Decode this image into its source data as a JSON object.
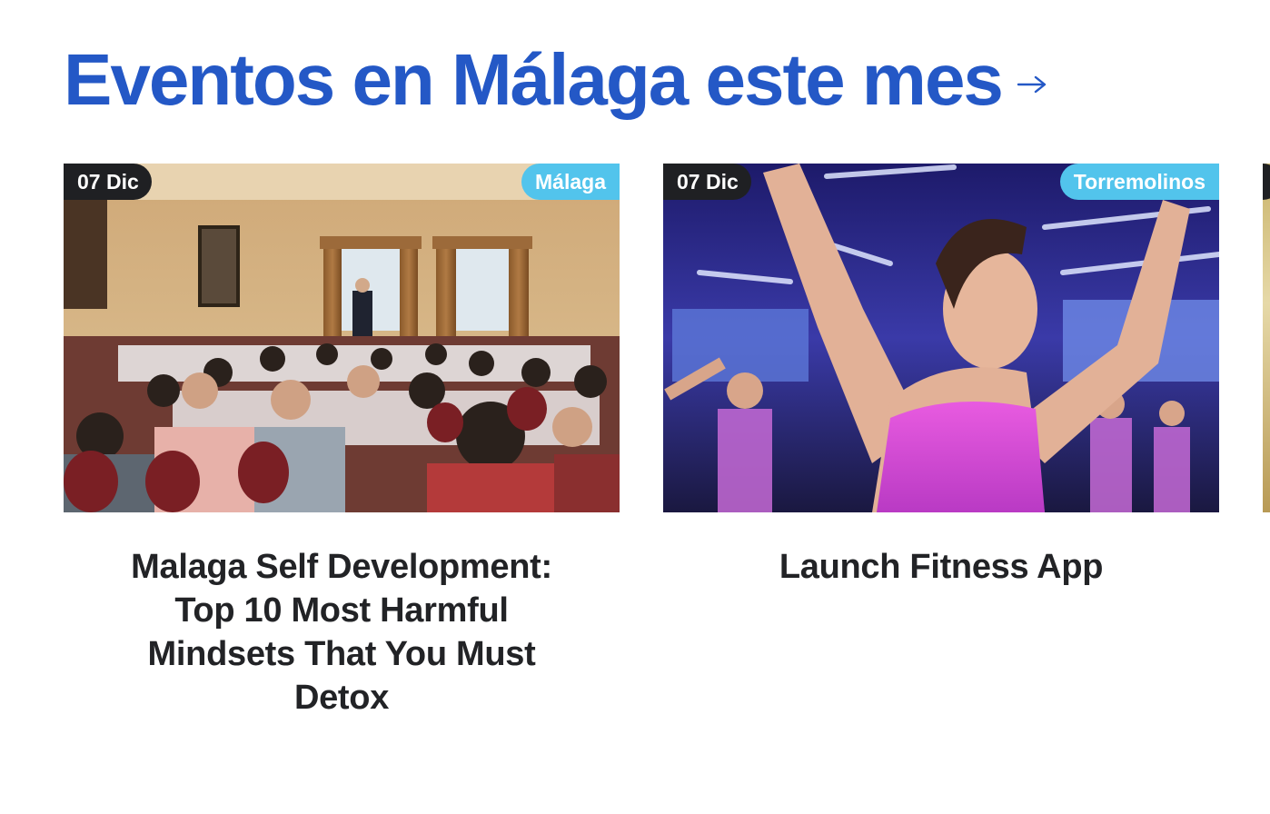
{
  "section": {
    "title": "Eventos en Málaga este mes",
    "arrow_icon": "arrow-right-icon",
    "title_color": "#2458c6"
  },
  "colors": {
    "date_badge_bg": "#1f2023",
    "location_badge_bg": "#52c4ec",
    "card_title_color": "#222326"
  },
  "events": [
    {
      "date": "07 Dic",
      "location": "Málaga",
      "title": "Malaga Self Development: Top 10 Most Harmful Mindsets That You Must Detox",
      "image": "conference-room-audience-photo"
    },
    {
      "date": "07 Dic",
      "location": "Torremolinos",
      "title": "Launch Fitness App",
      "image": "fitness-class-dancing-photo"
    },
    {
      "date": "",
      "location": "",
      "title": "",
      "image": "partially-visible-event-photo"
    }
  ]
}
